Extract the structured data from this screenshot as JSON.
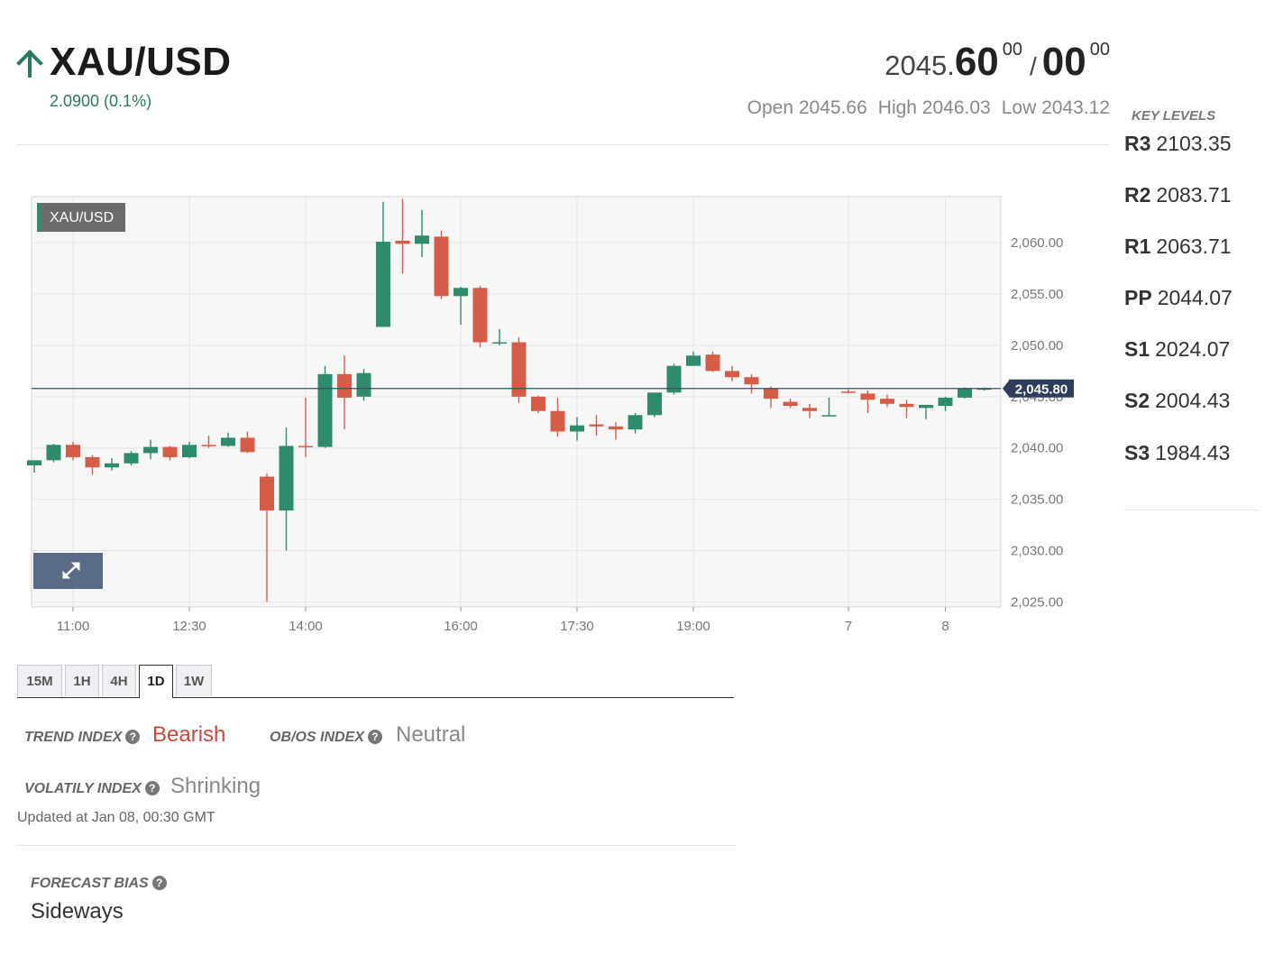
{
  "header": {
    "symbol": "XAU/USD",
    "direction_icon": "arrow-up-icon",
    "change": "2.0900 (0.1%)",
    "quote": {
      "bid_integer": "2045.",
      "bid_main": "60",
      "bid_sup": "00",
      "slash": "/",
      "ask_main": "00",
      "ask_sup": "00"
    },
    "open": "Open 2045.66",
    "high": "High 2046.03",
    "low": "Low 2043.12"
  },
  "key_levels": {
    "title": "KEY LEVELS",
    "items": [
      {
        "label": "R3",
        "value": "2103.35"
      },
      {
        "label": "R2",
        "value": "2083.71"
      },
      {
        "label": "R1",
        "value": "2063.71"
      },
      {
        "label": "PP",
        "value": "2044.07"
      },
      {
        "label": "S1",
        "value": "2024.07"
      },
      {
        "label": "S2",
        "value": "2004.43"
      },
      {
        "label": "S3",
        "value": "1984.43"
      }
    ]
  },
  "chart_data": {
    "type": "candlestick",
    "legend_label": "XAU/USD",
    "current_price": 2045.8,
    "current_price_label": "2,045.80",
    "ylim": [
      2024.5,
      2064.5
    ],
    "y_ticks": [
      2060,
      2055,
      2050,
      2045,
      2040,
      2035,
      2030,
      2025
    ],
    "y_tick_labels": [
      "2,060.00",
      "2,055.00",
      "2,050.00",
      "2,045.00",
      "2,040.00",
      "2,035.00",
      "2,030.00",
      "2,025.00"
    ],
    "x_ticks": [
      {
        "label": "11:00",
        "index": 2
      },
      {
        "label": "12:30",
        "index": 8
      },
      {
        "label": "14:00",
        "index": 14
      },
      {
        "label": "16:00",
        "index": 22
      },
      {
        "label": "17:30",
        "index": 28
      },
      {
        "label": "19:00",
        "index": 34
      },
      {
        "label": "7",
        "index": 42
      },
      {
        "label": "8",
        "index": 47
      }
    ],
    "up_color": "#2e8b6e",
    "down_color": "#d45d48",
    "candles": [
      {
        "o": 2038.3,
        "h": 2038.8,
        "l": 2037.6,
        "c": 2038.8
      },
      {
        "o": 2038.8,
        "h": 2040.4,
        "l": 2038.6,
        "c": 2040.3
      },
      {
        "o": 2040.3,
        "h": 2040.6,
        "l": 2038.8,
        "c": 2039.1
      },
      {
        "o": 2039.1,
        "h": 2039.3,
        "l": 2037.4,
        "c": 2038.1
      },
      {
        "o": 2038.1,
        "h": 2039.0,
        "l": 2037.8,
        "c": 2038.5
      },
      {
        "o": 2038.5,
        "h": 2039.7,
        "l": 2038.3,
        "c": 2039.5
      },
      {
        "o": 2039.5,
        "h": 2040.8,
        "l": 2038.9,
        "c": 2040.1
      },
      {
        "o": 2040.1,
        "h": 2040.2,
        "l": 2038.8,
        "c": 2039.1
      },
      {
        "o": 2039.1,
        "h": 2040.6,
        "l": 2039.0,
        "c": 2040.3
      },
      {
        "o": 2040.3,
        "h": 2041.2,
        "l": 2040.0,
        "c": 2040.2
      },
      {
        "o": 2040.2,
        "h": 2041.5,
        "l": 2040.1,
        "c": 2041.0
      },
      {
        "o": 2041.0,
        "h": 2041.6,
        "l": 2039.5,
        "c": 2039.6
      },
      {
        "o": 2037.2,
        "h": 2037.5,
        "l": 2025.0,
        "c": 2033.9
      },
      {
        "o": 2033.9,
        "h": 2042.0,
        "l": 2030.0,
        "c": 2040.2
      },
      {
        "o": 2040.2,
        "h": 2044.9,
        "l": 2039.1,
        "c": 2040.1
      },
      {
        "o": 2040.1,
        "h": 2048.0,
        "l": 2040.0,
        "c": 2047.2
      },
      {
        "o": 2047.2,
        "h": 2049.0,
        "l": 2041.8,
        "c": 2044.9
      },
      {
        "o": 2045.0,
        "h": 2047.7,
        "l": 2044.6,
        "c": 2047.3
      },
      {
        "o": 2051.8,
        "h": 2064.0,
        "l": 2051.8,
        "c": 2060.1
      },
      {
        "o": 2060.2,
        "h": 2064.3,
        "l": 2057.0,
        "c": 2059.9
      },
      {
        "o": 2059.9,
        "h": 2063.2,
        "l": 2058.6,
        "c": 2060.7
      },
      {
        "o": 2060.6,
        "h": 2061.2,
        "l": 2054.5,
        "c": 2054.8
      },
      {
        "o": 2054.8,
        "h": 2055.7,
        "l": 2052.0,
        "c": 2055.6
      },
      {
        "o": 2055.6,
        "h": 2055.8,
        "l": 2049.8,
        "c": 2050.3
      },
      {
        "o": 2050.3,
        "h": 2051.6,
        "l": 2050.0,
        "c": 2050.3
      },
      {
        "o": 2050.3,
        "h": 2050.8,
        "l": 2044.4,
        "c": 2045.0
      },
      {
        "o": 2045.0,
        "h": 2045.1,
        "l": 2043.4,
        "c": 2043.6
      },
      {
        "o": 2043.6,
        "h": 2044.9,
        "l": 2041.1,
        "c": 2041.6
      },
      {
        "o": 2041.6,
        "h": 2043.0,
        "l": 2040.7,
        "c": 2042.2
      },
      {
        "o": 2042.3,
        "h": 2043.2,
        "l": 2041.2,
        "c": 2042.1
      },
      {
        "o": 2042.1,
        "h": 2042.5,
        "l": 2040.8,
        "c": 2041.8
      },
      {
        "o": 2041.8,
        "h": 2043.4,
        "l": 2041.4,
        "c": 2043.2
      },
      {
        "o": 2043.2,
        "h": 2045.3,
        "l": 2043.0,
        "c": 2045.4
      },
      {
        "o": 2045.4,
        "h": 2048.2,
        "l": 2045.2,
        "c": 2048.0
      },
      {
        "o": 2048.0,
        "h": 2049.4,
        "l": 2048.0,
        "c": 2049.0
      },
      {
        "o": 2049.1,
        "h": 2049.4,
        "l": 2047.4,
        "c": 2047.5
      },
      {
        "o": 2047.5,
        "h": 2048.0,
        "l": 2046.5,
        "c": 2046.9
      },
      {
        "o": 2046.9,
        "h": 2047.2,
        "l": 2045.3,
        "c": 2046.2
      },
      {
        "o": 2045.8,
        "h": 2046.0,
        "l": 2043.9,
        "c": 2044.8
      },
      {
        "o": 2044.5,
        "h": 2044.8,
        "l": 2043.9,
        "c": 2044.1
      },
      {
        "o": 2043.9,
        "h": 2044.3,
        "l": 2042.9,
        "c": 2043.6
      },
      {
        "o": 2043.2,
        "h": 2044.9,
        "l": 2043.1,
        "c": 2043.2
      },
      {
        "o": 2045.5,
        "h": 2045.7,
        "l": 2045.3,
        "c": 2045.4
      },
      {
        "o": 2045.3,
        "h": 2045.6,
        "l": 2043.4,
        "c": 2044.7
      },
      {
        "o": 2044.8,
        "h": 2045.2,
        "l": 2044.0,
        "c": 2044.3
      },
      {
        "o": 2044.3,
        "h": 2044.7,
        "l": 2042.9,
        "c": 2044.0
      },
      {
        "o": 2043.9,
        "h": 2044.1,
        "l": 2042.8,
        "c": 2044.2
      },
      {
        "o": 2044.1,
        "h": 2045.0,
        "l": 2043.6,
        "c": 2044.9
      },
      {
        "o": 2044.9,
        "h": 2045.9,
        "l": 2044.8,
        "c": 2045.8
      },
      {
        "o": 2045.8,
        "h": 2045.9,
        "l": 2045.6,
        "c": 2045.8
      }
    ]
  },
  "timeframes": {
    "tabs": [
      "15M",
      "1H",
      "4H",
      "1D",
      "1W"
    ],
    "active": "1D"
  },
  "indexes": {
    "trend_label": "TREND INDEX",
    "trend_value": "Bearish",
    "obos_label": "OB/OS INDEX",
    "obos_value": "Neutral",
    "volatility_label": "VOLATILY INDEX",
    "volatility_value": "Shrinking",
    "updated": "Updated at Jan 08, 00:30 GMT",
    "help_icon": "question-circle-icon"
  },
  "forecast": {
    "label": "FORECAST BIAS",
    "value": "Sideways"
  }
}
